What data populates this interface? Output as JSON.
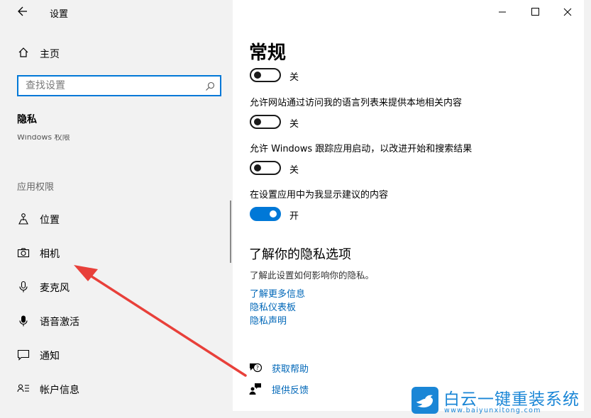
{
  "window": {
    "app_title": "设置",
    "back_icon": "back-arrow-icon",
    "controls": [
      "minimize-icon",
      "maximize-icon",
      "close-icon"
    ]
  },
  "sidebar": {
    "home_label": "主页",
    "search_placeholder": "查找设置",
    "section_title": "隐私",
    "clipped_item": "Windows 权限",
    "group_heading": "应用权限",
    "items": [
      {
        "label": "位置",
        "icon": "location-icon"
      },
      {
        "label": "相机",
        "icon": "camera-icon"
      },
      {
        "label": "麦克风",
        "icon": "microphone-icon"
      },
      {
        "label": "语音激活",
        "icon": "voice-activation-icon"
      },
      {
        "label": "通知",
        "icon": "notification-icon"
      },
      {
        "label": "帐户信息",
        "icon": "account-info-icon"
      }
    ]
  },
  "main": {
    "heading": "常规",
    "settings": [
      {
        "text": "",
        "state": "关",
        "on": false
      },
      {
        "text": "允许网站通过访问我的语言列表来提供本地相关内容",
        "state": "关",
        "on": false
      },
      {
        "text": "允许 Windows 跟踪应用启动，以改进开始和搜索结果",
        "state": "关",
        "on": false
      },
      {
        "text": "在设置应用中为我显示建议的内容",
        "state": "开",
        "on": true
      }
    ],
    "privacy_heading": "了解你的隐私选项",
    "privacy_desc": "了解此设置如何影响你的隐私。",
    "links": [
      "了解更多信息",
      "隐私仪表板",
      "隐私声明"
    ],
    "help": [
      {
        "label": "获取帮助",
        "icon": "get-help-icon"
      },
      {
        "label": "提供反馈",
        "icon": "feedback-icon"
      }
    ]
  },
  "watermark": {
    "title": "白云一键重装系统",
    "url": "www.baiyunxitong.com"
  },
  "colors": {
    "accent": "#0078d7",
    "link": "#0067b8",
    "annotation": "#e8403a",
    "watermark": "#1a86d6"
  }
}
